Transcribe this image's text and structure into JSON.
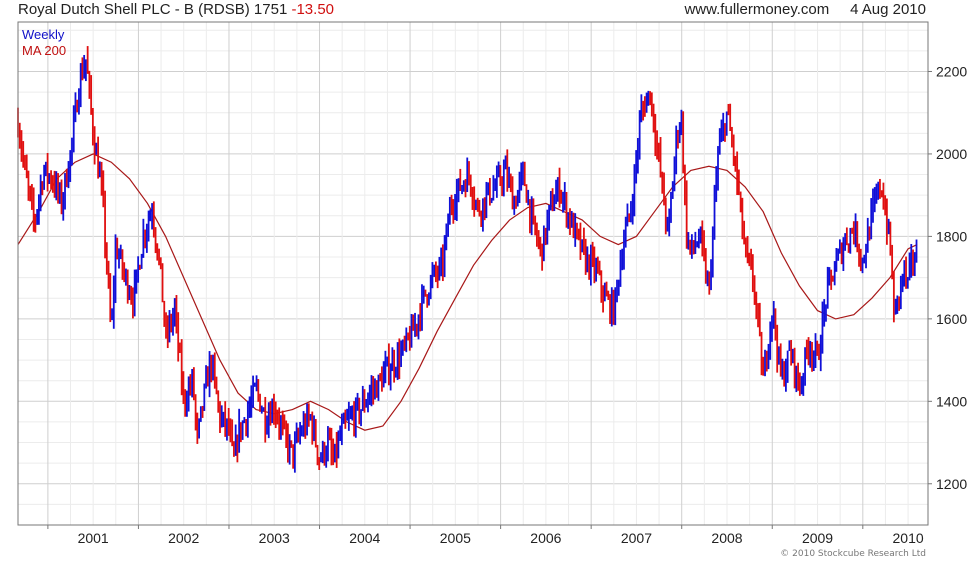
{
  "header": {
    "title": "Royal Dutch Shell PLC - B (RDSB)",
    "last": "1751",
    "change": "-13.50",
    "site": "www.fullermoney.com",
    "date": "4 Aug 2010"
  },
  "legend": {
    "weekly": "Weekly",
    "ma": "MA 200"
  },
  "footer": {
    "copyright": "© 2010 Stockcube Research Ltd"
  },
  "colors": {
    "up": "#1010d8",
    "down": "#e01010",
    "ma": "#a81818",
    "grid_major": "#cfcfcf",
    "grid_minor": "#ececec",
    "frame": "#777777"
  },
  "chart_data": {
    "type": "line",
    "title": "Royal Dutch Shell PLC - B (RDSB)",
    "xlabel": "",
    "ylabel": "",
    "y_axis_side": "right",
    "xlim": [
      2000.67,
      2010.72
    ],
    "ylim": [
      1100,
      2320
    ],
    "x_ticks": [
      2001,
      2002,
      2003,
      2004,
      2005,
      2006,
      2007,
      2008,
      2009,
      2010
    ],
    "x_tick_labels": [
      "2001",
      "2002",
      "2003",
      "2004",
      "2005",
      "2006",
      "2007",
      "2008",
      "2009",
      "2010"
    ],
    "y_ticks": [
      1200,
      1400,
      1600,
      1800,
      2000,
      2200
    ],
    "y_tick_labels": [
      "1200",
      "1400",
      "1600",
      "1800",
      "2000",
      "2200"
    ],
    "grid": true,
    "series": [
      {
        "name": "Weekly",
        "style": "weekly high-low bars, blue on up weeks, red on down weeks",
        "x": [
          2000.67,
          2000.75,
          2000.85,
          2000.95,
          2001.05,
          2001.15,
          2001.25,
          2001.35,
          2001.42,
          2001.5,
          2001.6,
          2001.7,
          2001.75,
          2001.85,
          2001.95,
          2002.05,
          2002.15,
          2002.25,
          2002.3,
          2002.4,
          2002.5,
          2002.6,
          2002.65,
          2002.7,
          2002.8,
          2002.9,
          2003.0,
          2003.05,
          2003.1,
          2003.2,
          2003.3,
          2003.4,
          2003.5,
          2003.6,
          2003.7,
          2003.8,
          2003.9,
          2004.0,
          2004.1,
          2004.15,
          2004.25,
          2004.35,
          2004.45,
          2004.55,
          2004.65,
          2004.75,
          2004.85,
          2004.95,
          2005.05,
          2005.15,
          2005.25,
          2005.35,
          2005.45,
          2005.55,
          2005.65,
          2005.75,
          2005.85,
          2005.95,
          2006.05,
          2006.15,
          2006.25,
          2006.35,
          2006.45,
          2006.55,
          2006.65,
          2006.75,
          2006.85,
          2006.95,
          2007.05,
          2007.15,
          2007.25,
          2007.35,
          2007.45,
          2007.55,
          2007.65,
          2007.75,
          2007.85,
          2007.95,
          2008.0,
          2008.05,
          2008.1,
          2008.2,
          2008.3,
          2008.4,
          2008.5,
          2008.6,
          2008.7,
          2008.75,
          2008.8,
          2008.9,
          2009.0,
          2009.1,
          2009.2,
          2009.25,
          2009.3,
          2009.4,
          2009.5,
          2009.6,
          2009.7,
          2009.8,
          2009.9,
          2010.0,
          2010.1,
          2010.2,
          2010.3,
          2010.35,
          2010.45,
          2010.5,
          2010.55,
          2010.6
        ],
        "values": [
          2080,
          1950,
          1830,
          1960,
          1940,
          1880,
          2000,
          2180,
          2230,
          2050,
          1900,
          1560,
          1780,
          1700,
          1650,
          1800,
          1870,
          1700,
          1550,
          1620,
          1400,
          1450,
          1300,
          1380,
          1500,
          1360,
          1330,
          1250,
          1320,
          1370,
          1430,
          1360,
          1390,
          1320,
          1270,
          1330,
          1360,
          1260,
          1300,
          1250,
          1330,
          1360,
          1380,
          1420,
          1440,
          1480,
          1500,
          1530,
          1580,
          1650,
          1700,
          1720,
          1880,
          1920,
          1950,
          1860,
          1900,
          1920,
          1960,
          1880,
          1950,
          1830,
          1760,
          1870,
          1920,
          1850,
          1790,
          1740,
          1720,
          1650,
          1620,
          1780,
          1880,
          2100,
          2150,
          1980,
          1800,
          2060,
          2080,
          1810,
          1760,
          1800,
          1660,
          2000,
          2100,
          1960,
          1760,
          1720,
          1680,
          1450,
          1630,
          1450,
          1520,
          1480,
          1430,
          1540,
          1500,
          1660,
          1730,
          1790,
          1820,
          1740,
          1850,
          1930,
          1780,
          1600,
          1720,
          1680,
          1750,
          1751
        ]
      },
      {
        "name": "MA 200",
        "style": "thin line",
        "x": [
          2000.67,
          2000.9,
          2001.1,
          2001.3,
          2001.5,
          2001.7,
          2001.9,
          2002.1,
          2002.3,
          2002.5,
          2002.7,
          2002.9,
          2003.1,
          2003.3,
          2003.5,
          2003.7,
          2003.9,
          2004.1,
          2004.3,
          2004.5,
          2004.7,
          2004.9,
          2005.1,
          2005.3,
          2005.5,
          2005.7,
          2005.9,
          2006.1,
          2006.3,
          2006.5,
          2006.7,
          2006.9,
          2007.1,
          2007.3,
          2007.5,
          2007.7,
          2007.9,
          2008.1,
          2008.3,
          2008.5,
          2008.7,
          2008.9,
          2009.1,
          2009.3,
          2009.5,
          2009.7,
          2009.9,
          2010.1,
          2010.3,
          2010.5,
          2010.6
        ],
        "values": [
          1780,
          1860,
          1940,
          1980,
          2000,
          1980,
          1940,
          1880,
          1800,
          1700,
          1600,
          1500,
          1420,
          1380,
          1370,
          1380,
          1400,
          1380,
          1350,
          1330,
          1340,
          1400,
          1480,
          1570,
          1650,
          1730,
          1790,
          1840,
          1870,
          1880,
          1860,
          1840,
          1800,
          1780,
          1800,
          1860,
          1920,
          1960,
          1970,
          1960,
          1920,
          1860,
          1760,
          1680,
          1620,
          1600,
          1610,
          1650,
          1700,
          1770,
          1780
        ]
      }
    ]
  }
}
